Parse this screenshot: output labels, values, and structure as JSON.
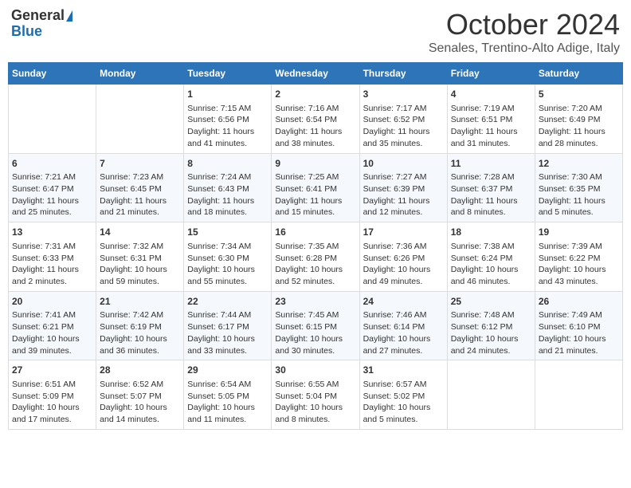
{
  "logo": {
    "general": "General",
    "blue": "Blue"
  },
  "title": "October 2024",
  "subtitle": "Senales, Trentino-Alto Adige, Italy",
  "weekdays": [
    "Sunday",
    "Monday",
    "Tuesday",
    "Wednesday",
    "Thursday",
    "Friday",
    "Saturday"
  ],
  "weeks": [
    [
      {
        "day": "",
        "text": ""
      },
      {
        "day": "",
        "text": ""
      },
      {
        "day": "1",
        "text": "Sunrise: 7:15 AM\nSunset: 6:56 PM\nDaylight: 11 hours and 41 minutes."
      },
      {
        "day": "2",
        "text": "Sunrise: 7:16 AM\nSunset: 6:54 PM\nDaylight: 11 hours and 38 minutes."
      },
      {
        "day": "3",
        "text": "Sunrise: 7:17 AM\nSunset: 6:52 PM\nDaylight: 11 hours and 35 minutes."
      },
      {
        "day": "4",
        "text": "Sunrise: 7:19 AM\nSunset: 6:51 PM\nDaylight: 11 hours and 31 minutes."
      },
      {
        "day": "5",
        "text": "Sunrise: 7:20 AM\nSunset: 6:49 PM\nDaylight: 11 hours and 28 minutes."
      }
    ],
    [
      {
        "day": "6",
        "text": "Sunrise: 7:21 AM\nSunset: 6:47 PM\nDaylight: 11 hours and 25 minutes."
      },
      {
        "day": "7",
        "text": "Sunrise: 7:23 AM\nSunset: 6:45 PM\nDaylight: 11 hours and 21 minutes."
      },
      {
        "day": "8",
        "text": "Sunrise: 7:24 AM\nSunset: 6:43 PM\nDaylight: 11 hours and 18 minutes."
      },
      {
        "day": "9",
        "text": "Sunrise: 7:25 AM\nSunset: 6:41 PM\nDaylight: 11 hours and 15 minutes."
      },
      {
        "day": "10",
        "text": "Sunrise: 7:27 AM\nSunset: 6:39 PM\nDaylight: 11 hours and 12 minutes."
      },
      {
        "day": "11",
        "text": "Sunrise: 7:28 AM\nSunset: 6:37 PM\nDaylight: 11 hours and 8 minutes."
      },
      {
        "day": "12",
        "text": "Sunrise: 7:30 AM\nSunset: 6:35 PM\nDaylight: 11 hours and 5 minutes."
      }
    ],
    [
      {
        "day": "13",
        "text": "Sunrise: 7:31 AM\nSunset: 6:33 PM\nDaylight: 11 hours and 2 minutes."
      },
      {
        "day": "14",
        "text": "Sunrise: 7:32 AM\nSunset: 6:31 PM\nDaylight: 10 hours and 59 minutes."
      },
      {
        "day": "15",
        "text": "Sunrise: 7:34 AM\nSunset: 6:30 PM\nDaylight: 10 hours and 55 minutes."
      },
      {
        "day": "16",
        "text": "Sunrise: 7:35 AM\nSunset: 6:28 PM\nDaylight: 10 hours and 52 minutes."
      },
      {
        "day": "17",
        "text": "Sunrise: 7:36 AM\nSunset: 6:26 PM\nDaylight: 10 hours and 49 minutes."
      },
      {
        "day": "18",
        "text": "Sunrise: 7:38 AM\nSunset: 6:24 PM\nDaylight: 10 hours and 46 minutes."
      },
      {
        "day": "19",
        "text": "Sunrise: 7:39 AM\nSunset: 6:22 PM\nDaylight: 10 hours and 43 minutes."
      }
    ],
    [
      {
        "day": "20",
        "text": "Sunrise: 7:41 AM\nSunset: 6:21 PM\nDaylight: 10 hours and 39 minutes."
      },
      {
        "day": "21",
        "text": "Sunrise: 7:42 AM\nSunset: 6:19 PM\nDaylight: 10 hours and 36 minutes."
      },
      {
        "day": "22",
        "text": "Sunrise: 7:44 AM\nSunset: 6:17 PM\nDaylight: 10 hours and 33 minutes."
      },
      {
        "day": "23",
        "text": "Sunrise: 7:45 AM\nSunset: 6:15 PM\nDaylight: 10 hours and 30 minutes."
      },
      {
        "day": "24",
        "text": "Sunrise: 7:46 AM\nSunset: 6:14 PM\nDaylight: 10 hours and 27 minutes."
      },
      {
        "day": "25",
        "text": "Sunrise: 7:48 AM\nSunset: 6:12 PM\nDaylight: 10 hours and 24 minutes."
      },
      {
        "day": "26",
        "text": "Sunrise: 7:49 AM\nSunset: 6:10 PM\nDaylight: 10 hours and 21 minutes."
      }
    ],
    [
      {
        "day": "27",
        "text": "Sunrise: 6:51 AM\nSunset: 5:09 PM\nDaylight: 10 hours and 17 minutes."
      },
      {
        "day": "28",
        "text": "Sunrise: 6:52 AM\nSunset: 5:07 PM\nDaylight: 10 hours and 14 minutes."
      },
      {
        "day": "29",
        "text": "Sunrise: 6:54 AM\nSunset: 5:05 PM\nDaylight: 10 hours and 11 minutes."
      },
      {
        "day": "30",
        "text": "Sunrise: 6:55 AM\nSunset: 5:04 PM\nDaylight: 10 hours and 8 minutes."
      },
      {
        "day": "31",
        "text": "Sunrise: 6:57 AM\nSunset: 5:02 PM\nDaylight: 10 hours and 5 minutes."
      },
      {
        "day": "",
        "text": ""
      },
      {
        "day": "",
        "text": ""
      }
    ]
  ]
}
